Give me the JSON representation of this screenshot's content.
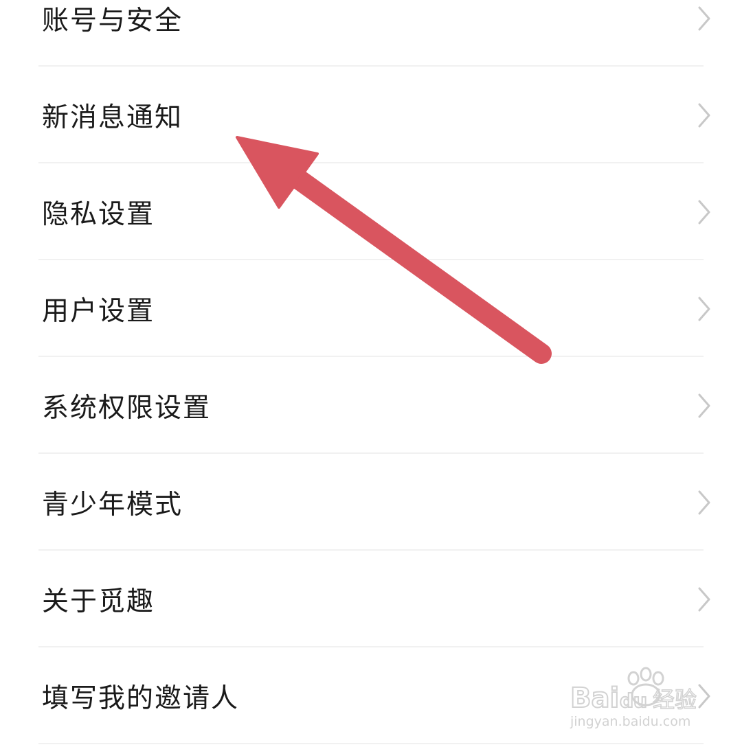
{
  "settings": {
    "items": [
      {
        "label": "账号与安全"
      },
      {
        "label": "新消息通知"
      },
      {
        "label": "隐私设置"
      },
      {
        "label": "用户设置"
      },
      {
        "label": "系统权限设置"
      },
      {
        "label": "青少年模式"
      },
      {
        "label": "关于觅趣"
      },
      {
        "label": "填写我的邀请人"
      }
    ]
  },
  "annotation": {
    "type": "arrow",
    "color": "#d9555f",
    "points_to": "新消息通知"
  },
  "watermark": {
    "logo": "Baidu经验",
    "url": "jingyan.baidu.com",
    "color": "#d2d2d2"
  },
  "icons": {
    "row_chevron": "chevron-right-icon"
  },
  "colors": {
    "background": "#ffffff",
    "text": "#1a1a1a",
    "chevron": "#c8c8c8",
    "divider": "#f1f1f1"
  }
}
